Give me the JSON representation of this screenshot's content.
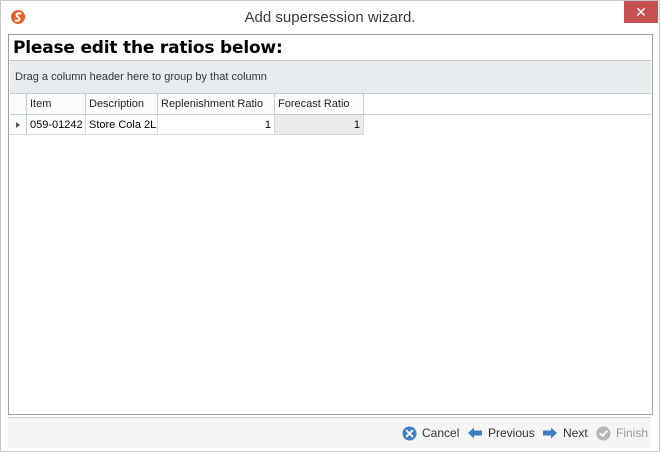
{
  "window": {
    "title": "Add supersession wizard.",
    "close_glyph": "✕"
  },
  "heading": "Please edit the ratios below:",
  "grid": {
    "group_panel_text": "Drag a column header here to group by that column",
    "columns": [
      "Item",
      "Description",
      "Replenishment Ratio",
      "Forecast Ratio"
    ],
    "rows": [
      {
        "item": "059-01242",
        "description": "Store Cola 2L",
        "replenishment_ratio": "1",
        "forecast_ratio": "1"
      }
    ]
  },
  "buttons": {
    "cancel": "Cancel",
    "previous": "Previous",
    "next": "Next",
    "finish": "Finish"
  },
  "icons": {
    "app": "app-logo-icon",
    "cancel": "cancel-circle-icon",
    "previous": "arrow-left-icon",
    "next": "arrow-right-icon",
    "finish": "check-circle-icon"
  },
  "colors": {
    "close_button": "#c75050",
    "accent_blue": "#3c7fc4",
    "logo_orange": "#e8632b"
  }
}
